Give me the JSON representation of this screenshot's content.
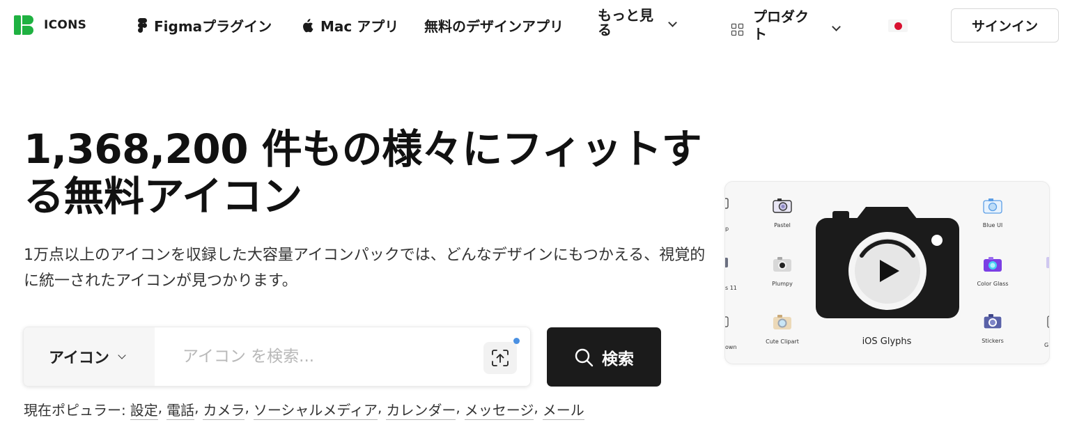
{
  "header": {
    "logo_text": "ICONS",
    "nav": {
      "figma_label": "Figmaプラグイン",
      "mac_label": "Mac アプリ",
      "free_label": "無料のデザインアプリ",
      "more_label": "もっと見る",
      "products_label": "プロダクト"
    },
    "signin_label": "サインイン"
  },
  "hero": {
    "title": "1,368,200 件もの様々にフィットする無料アイコン",
    "subtitle": "1万点以上のアイコンを収録した大容量アイコンパックでは、どんなデザインにもつかえる、視覚的に統一されたアイコンが見つかります。"
  },
  "search": {
    "type_label": "アイコン",
    "placeholder": "アイコン を検索...",
    "value": "",
    "button_label": "検索"
  },
  "popular": {
    "prefix": "現在ポピュラー:",
    "tags": [
      "設定",
      "電話",
      "カメラ",
      "ソーシャルメディア",
      "カレンダー",
      "メッセージ",
      "メール"
    ]
  },
  "preview": {
    "main_label": "iOS Glyphs",
    "styles": {
      "pastel": "Pastel",
      "blue_ui": "Blue UI",
      "plumpy": "Plumpy",
      "color_glass": "Color Glass",
      "cute_clipart": "Cute Clipart",
      "stickers": "Stickers"
    },
    "cut_labels": {
      "left_top": "p",
      "left_mid": "s 11",
      "left_bot": "own",
      "right_bot": "Gl"
    },
    "colors": {
      "card_bg": "#f7f7f7",
      "glyph": "#1b1b1b",
      "blue_ui": "#5b9ee6",
      "color_glass": "#7b3fe4"
    }
  },
  "colors": {
    "brand_green": "#1fb141",
    "dark_button": "#1b1b1b",
    "flag_red": "#d8102f",
    "accent_dot": "#4a90e2"
  }
}
